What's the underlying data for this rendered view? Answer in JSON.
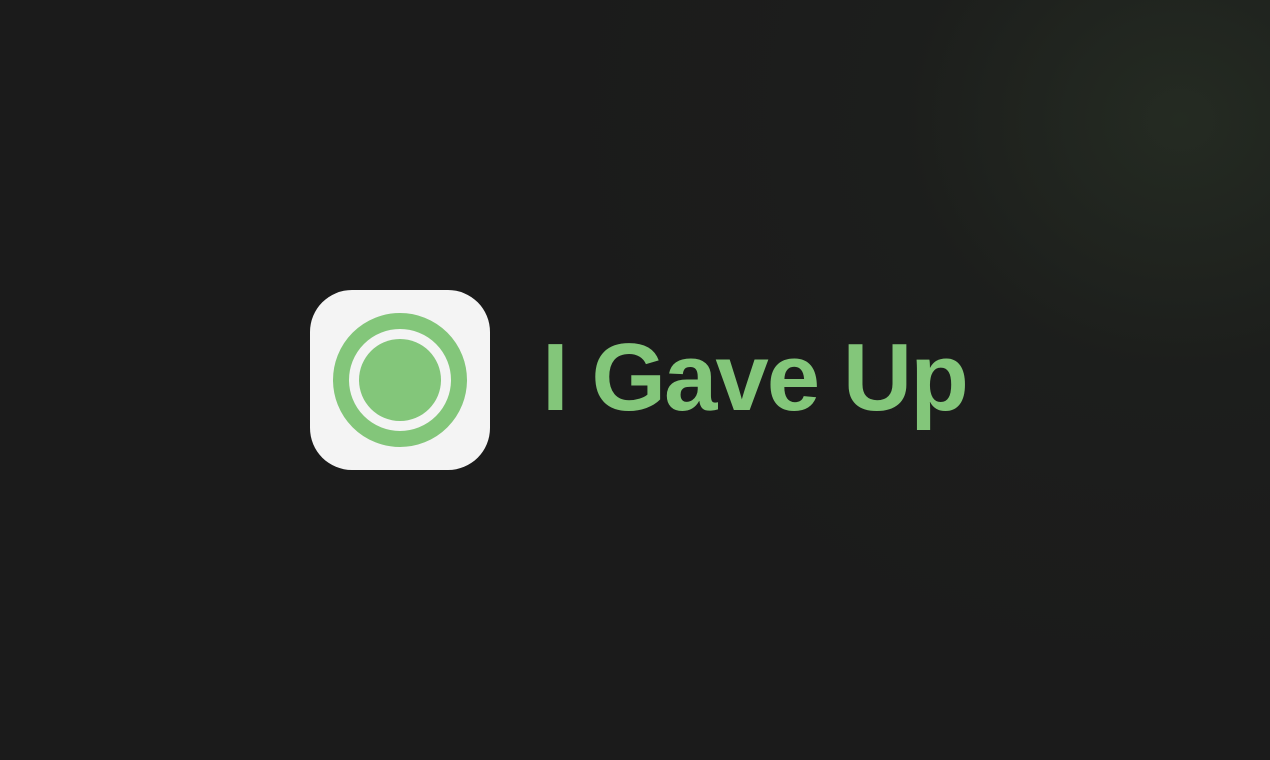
{
  "brand": {
    "app_name": "I Gave Up",
    "icon": "target-ring-icon",
    "accent_color": "#83c67a",
    "icon_background": "#f4f4f4",
    "page_background": "#1b1b1b"
  }
}
